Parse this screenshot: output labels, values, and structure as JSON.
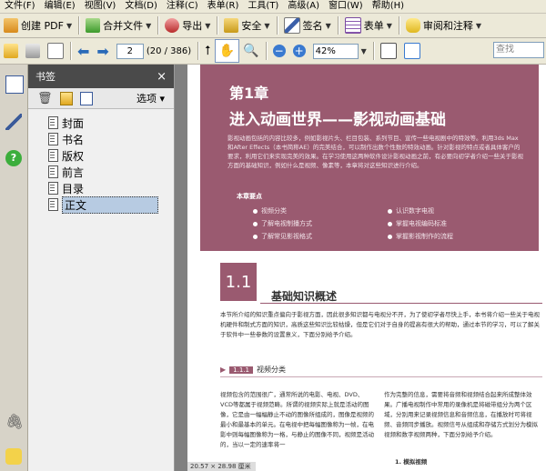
{
  "menu": [
    "文件(F)",
    "编辑(E)",
    "视图(V)",
    "文档(D)",
    "注释(C)",
    "表单(R)",
    "工具(T)",
    "高级(A)",
    "窗口(W)",
    "帮助(H)"
  ],
  "toolbar1": {
    "create_pdf": "创建 PDF",
    "merge": "合并文件",
    "export": "导出",
    "secure": "安全",
    "sign": "签名",
    "forms": "表单",
    "review": "审阅和注释"
  },
  "toolbar2": {
    "page_current": "2",
    "page_total": "(20 / 386)",
    "zoom": "42%",
    "search_placeholder": "查找"
  },
  "panel": {
    "title": "书签",
    "close": "×",
    "options": "选项",
    "bookmarks": [
      "封面",
      "书名",
      "版权",
      "前言",
      "目录",
      "正文"
    ],
    "selected_index": 5
  },
  "document": {
    "chapter_num": "第1章",
    "chapter_title": "进入动画世界——影视动画基础",
    "intro": "影视动画包括的内容比较多，例如影视片头、栏目包装、系列节目、宣传一些电视剧中的特效等。利用3ds Max和After Effects（本书简称AE）的完美结合，可以制作出数个性数的特效动画。针对影视的特点或者具体客户的要求，利用它们来实现完美的效果。在学习使用这两种软件设计影视动画之前，有必要向初学者介绍一些关于影视方面的基础知识，例如什么是视频、像素等，本章将对这些知识进行介绍。",
    "key_points_heading": "本章要点",
    "key_points_left": [
      "视频分类",
      "了解电视制播方式",
      "了解常见影视格式"
    ],
    "key_points_right": [
      "认识数字电视",
      "掌握电视编码标准",
      "掌握影视制作的流程"
    ],
    "section_num": "1.1",
    "section_title": "基础知识概述",
    "section_para": "本节所介绍的知识重点偏向于影视方面，因此很多知识都与电视分不开，为了使初学者尽快上手，本书将介绍一些关于电视机硬件和制式方面的知识，高质这些知识比较枯燥，但是它们对于自身的提高有很大的帮助，通过本节的学习，可以了解关于软件中一些参数的设置意义，下面分别给予介绍。",
    "subsection_num": "1.1.1",
    "subsection_title": "视频分类",
    "col_left": "视频包含的范围很广，通常所说的电影、电视、DVD、VCD等都属于视频范畴。所谓的视频实际上就是活动的图像，它是由一幅幅静止不动的图像所组成的，图像是视频的最小和最基本的单元。在电视中把每幅图像称为一帧，在电影中则每幅图像称为一格，与静止的图像不同，视频是活动的，当以一定的速率将一",
    "col_right": "作为完整的信息，需要将音频和视频结合起来所成整体效果。广播电视制作中常用的录像机是将磁带组分为两个区域，分别用来记录视频信息和音频信息，在播放时可将视频、音频同步播放。视频信号从组成和存储方式划分为模拟视频和数字视频两种，下面分别给予介绍。",
    "col_right_item": "1. 模拟视频"
  },
  "status": "20.57 × 28.98 厘米"
}
